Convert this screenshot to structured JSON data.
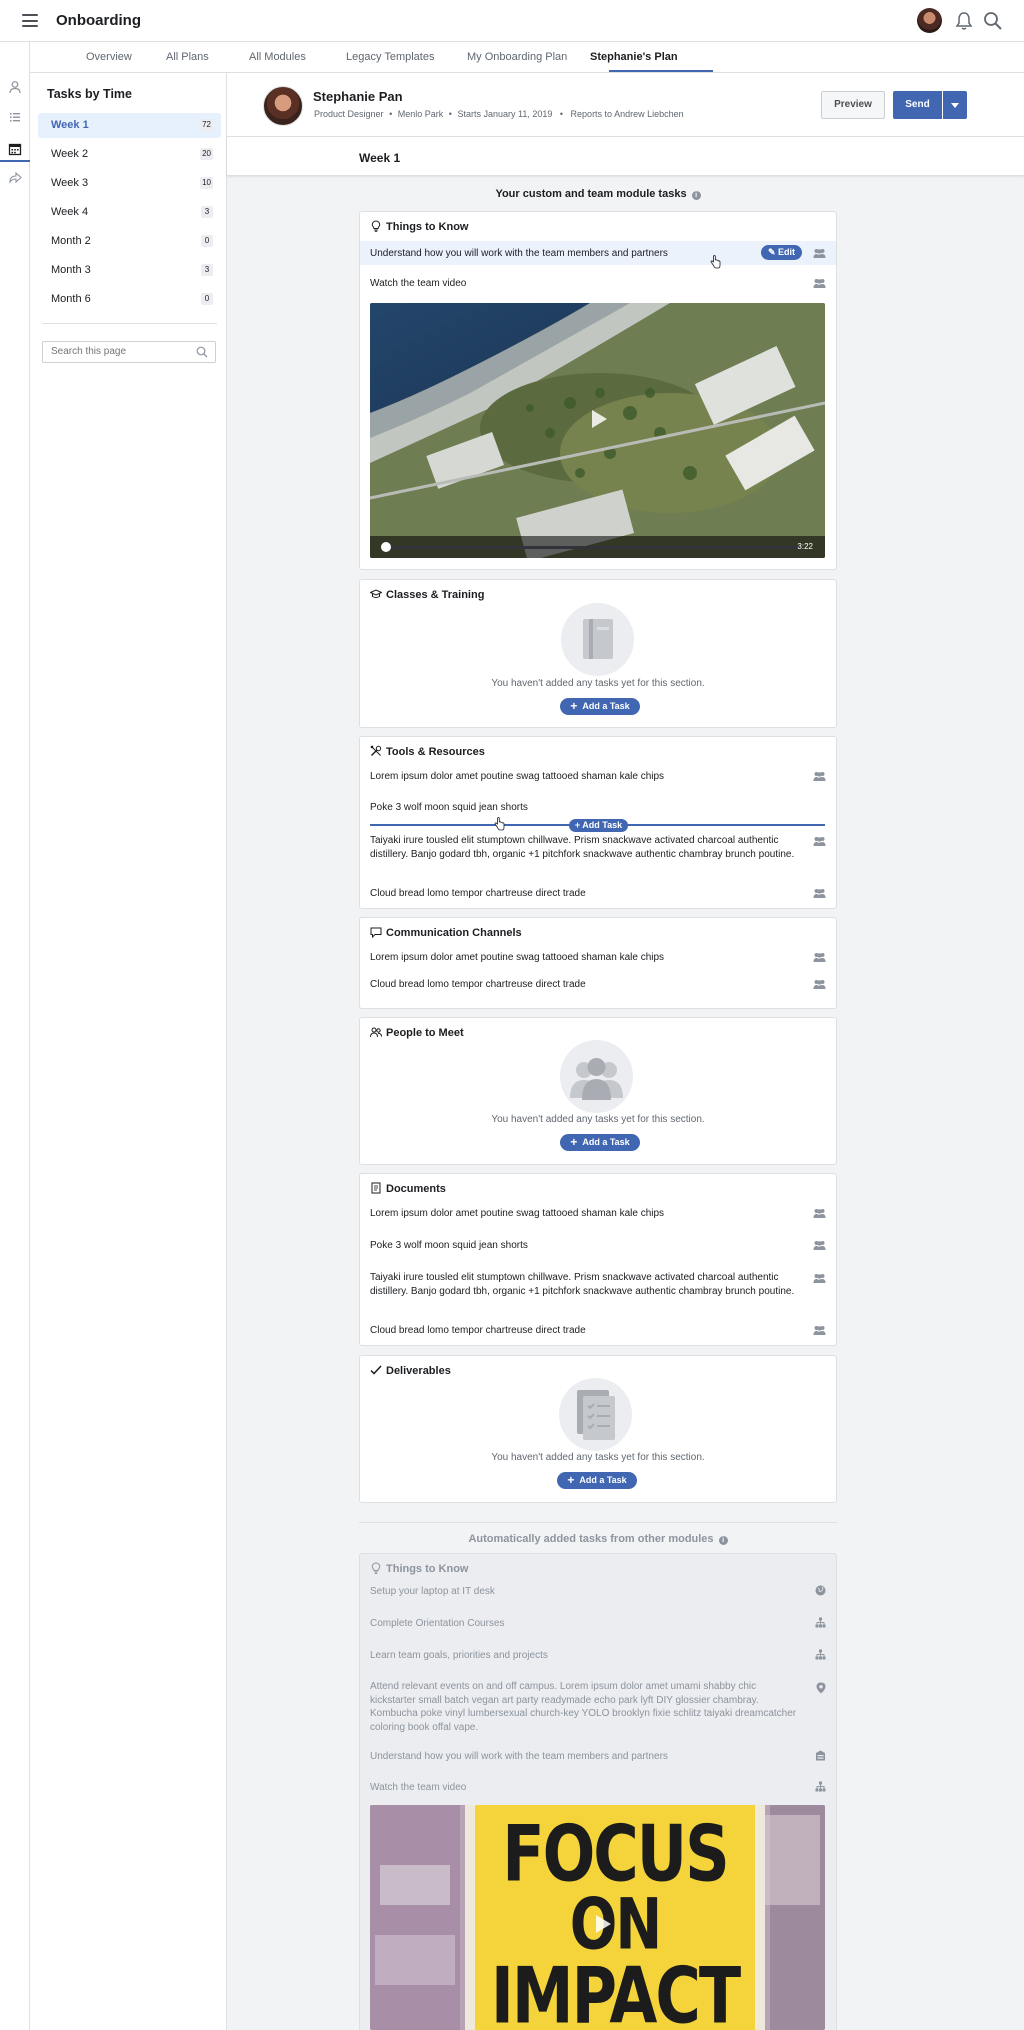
{
  "app": {
    "title": "Onboarding"
  },
  "tabs": [
    "Overview",
    "All Plans",
    "All Modules",
    "Legacy Templates",
    "My Onboarding Plan",
    "Stephanie's Plan"
  ],
  "sidebar": {
    "title": "Tasks by Time",
    "items": [
      {
        "label": "Week 1",
        "count": "72"
      },
      {
        "label": "Week 2",
        "count": "20"
      },
      {
        "label": "Week 3",
        "count": "10"
      },
      {
        "label": "Week 4",
        "count": "3"
      },
      {
        "label": "Month 2",
        "count": "0"
      },
      {
        "label": "Month 3",
        "count": "3"
      },
      {
        "label": "Month 6",
        "count": "0"
      }
    ],
    "search_placeholder": "Search this page"
  },
  "profile": {
    "name": "Stephanie Pan",
    "role": "Product Designer",
    "location": "Menlo Park",
    "start": "Starts January 11, 2019",
    "reports": "Reports to Andrew Liebchen",
    "sep": "•",
    "preview_label": "Preview",
    "send_label": "Send"
  },
  "week_title": "Week 1",
  "custom_title": "Your custom and team module tasks",
  "auto_title": "Automatically added tasks from other modules",
  "empty_text": "You haven't added any tasks yet for this section.",
  "add_task_label": "Add a Task",
  "insert_label": "Add Task",
  "edit_label": "Edit",
  "sections": {
    "things": {
      "title": "Things to Know",
      "tasks": [
        "Understand how you will work with the team members and partners",
        "Watch the team video"
      ],
      "video_duration": "3:22"
    },
    "classes": {
      "title": "Classes & Training"
    },
    "tools": {
      "title": "Tools & Resources",
      "tasks": [
        "Lorem ipsum dolor amet poutine swag tattooed shaman kale chips",
        "Poke 3 wolf moon squid jean shorts",
        "Taiyaki irure tousled elit stumptown chillwave. Prism snackwave activated charcoal authentic distillery. Banjo godard tbh, organic +1 pitchfork snackwave authentic chambray brunch poutine.",
        "Cloud bread lomo tempor chartreuse direct trade"
      ]
    },
    "comm": {
      "title": "Communication Channels",
      "tasks": [
        "Lorem ipsum dolor amet poutine swag tattooed shaman kale chips",
        "Cloud bread lomo tempor chartreuse direct trade"
      ]
    },
    "people": {
      "title": "People to Meet"
    },
    "docs": {
      "title": "Documents",
      "tasks": [
        "Lorem ipsum dolor amet poutine swag tattooed shaman kale chips",
        "Poke 3 wolf moon squid jean shorts",
        "Taiyaki irure tousled elit stumptown chillwave. Prism snackwave activated charcoal authentic distillery. Banjo godard tbh, organic +1 pitchfork snackwave authentic chambray brunch poutine.",
        "Cloud bread lomo tempor chartreuse direct trade"
      ]
    },
    "deliverables": {
      "title": "Deliverables"
    },
    "auto_things": {
      "title": "Things to Know",
      "tasks": [
        "Setup your laptop at IT desk",
        "Complete Orientation Courses",
        "Learn team goals, priorities and projects",
        "Attend relevant events on and off campus. Lorem ipsum dolor amet umami shabby chic kickstarter small batch vegan art party readymade echo park lyft DIY glossier chambray. Kombucha poke vinyl lumbersexual church-key YOLO brooklyn fixie schlitz taiyaki dreamcatcher coloring book offal vape.",
        "Understand how you will work with the team members and partners",
        "Watch the team video"
      ],
      "poster_words": [
        "FOCUS",
        "ON",
        "IMPACT"
      ]
    }
  },
  "colors": {
    "accent": "#4267b2",
    "highlight": "#ebf2fc",
    "poster_yellow": "#f4d43a"
  }
}
